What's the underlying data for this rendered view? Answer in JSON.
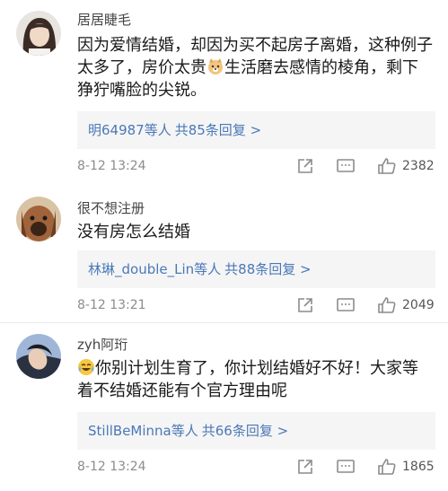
{
  "comments": [
    {
      "username": "居居睫毛",
      "text_line1": "因为爱情结婚，却因为买不起房子离婚，这种例子",
      "text_line2a": "太多了，房价太贵",
      "text_line2b": "生活磨去感情的棱角，剩下",
      "text_line3": "狰狞嘴脸的尖锐。",
      "emoji": "dog-face-emoji",
      "reply_users": "明64987等人",
      "reply_count": "共85条回复 >",
      "time": "8-12 13:24",
      "likes": "2382"
    },
    {
      "username": "很不想注册",
      "text_line1": "没有房怎么结婚",
      "reply_users": "林琳_double_Lin等人",
      "reply_count": "共88条回复 >",
      "time": "8-12 13:21",
      "likes": "2049"
    },
    {
      "username": "zyh阿珩",
      "emoji": "laughing-tears-emoji",
      "text_line1": "你别计划生育了，你计划结婚好不好！大家等",
      "text_line2": "着不结婚还能有个官方理由呢",
      "reply_users": "StillBeMinna等人",
      "reply_count": "共66条回复 >",
      "time": "8-12 13:24",
      "likes": "1865"
    }
  ],
  "colors": {
    "link": "#4a78b8",
    "meta": "#8c8c8c",
    "reply_bg": "#f5f5f5"
  },
  "icons": [
    "share-icon",
    "reply-icon",
    "like-icon"
  ]
}
